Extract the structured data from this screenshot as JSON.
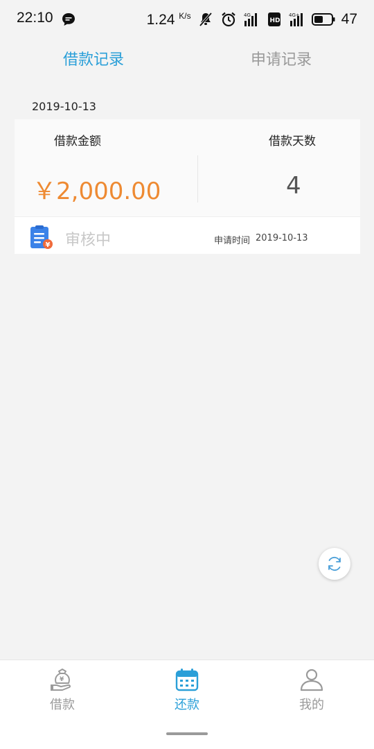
{
  "status_bar": {
    "time": "22:10",
    "net_speed": "1.24",
    "net_speed_unit": "K/s",
    "battery": "47",
    "icons": [
      "message-icon",
      "mute-icon",
      "alarm-icon",
      "signal-4g-icon",
      "hd-icon",
      "signal-4g-plus-icon",
      "battery-icon"
    ]
  },
  "tabs": [
    {
      "label": "借款记录",
      "active": true
    },
    {
      "label": "申请记录",
      "active": false
    }
  ],
  "record": {
    "date": "2019-10-13",
    "amount_label": "借款金额",
    "days_label": "借款天数",
    "amount": "￥2,000.00",
    "days": "4",
    "status": "审核中",
    "apply_time_label": "申请时间",
    "apply_time": "2019-10-13"
  },
  "refresh": {
    "icon": "refresh-icon"
  },
  "bottom_nav": [
    {
      "label": "借款",
      "icon": "money-bag-icon",
      "active": false
    },
    {
      "label": "还款",
      "icon": "calendar-icon",
      "active": true
    },
    {
      "label": "我的",
      "icon": "user-icon",
      "active": false
    }
  ],
  "colors": {
    "accent": "#2a9fd8",
    "amount": "#ee8a32",
    "inactive": "#9a9a9a",
    "background": "#f3f3f3"
  }
}
